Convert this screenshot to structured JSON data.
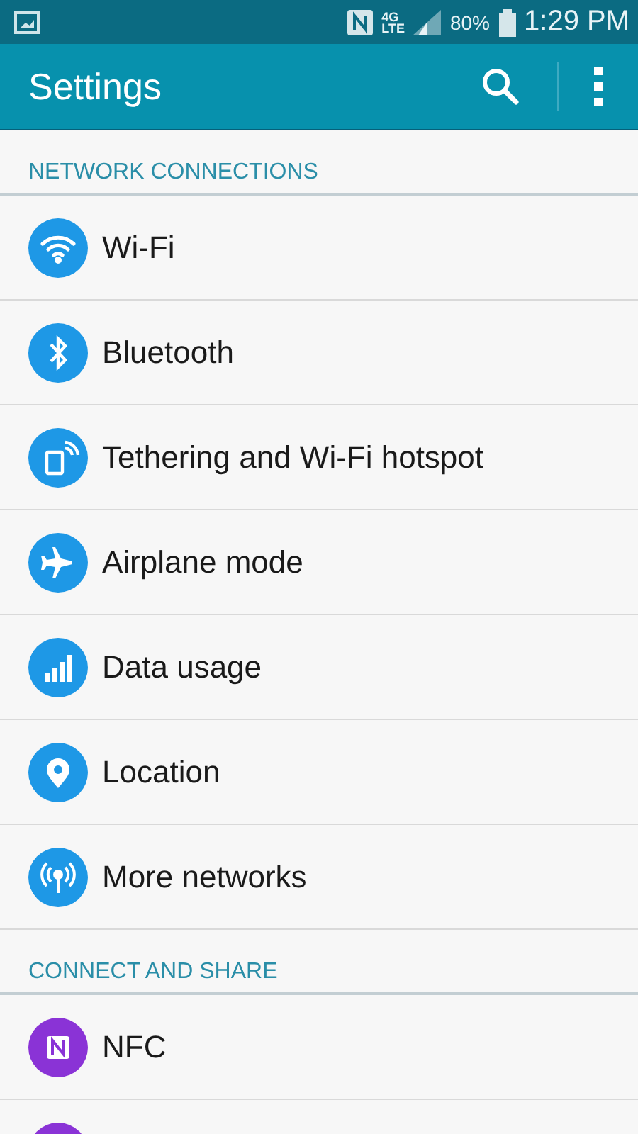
{
  "status_bar": {
    "network_type": "4G",
    "network_sub": "LTE",
    "battery": "80%",
    "time": "1:29 PM"
  },
  "app_bar": {
    "title": "Settings"
  },
  "sections": [
    {
      "title": "NETWORK CONNECTIONS",
      "items": [
        {
          "label": "Wi-Fi",
          "color": "#1e98e6"
        },
        {
          "label": "Bluetooth",
          "color": "#1e98e6"
        },
        {
          "label": "Tethering and Wi-Fi hotspot",
          "color": "#1e98e6"
        },
        {
          "label": "Airplane mode",
          "color": "#1e98e6"
        },
        {
          "label": "Data usage",
          "color": "#1e98e6"
        },
        {
          "label": "Location",
          "color": "#1e98e6"
        },
        {
          "label": "More networks",
          "color": "#1e98e6"
        }
      ]
    },
    {
      "title": "CONNECT AND SHARE",
      "items": [
        {
          "label": "NFC",
          "color": "#8a33d6"
        },
        {
          "color": "#8a33d6"
        }
      ]
    }
  ]
}
